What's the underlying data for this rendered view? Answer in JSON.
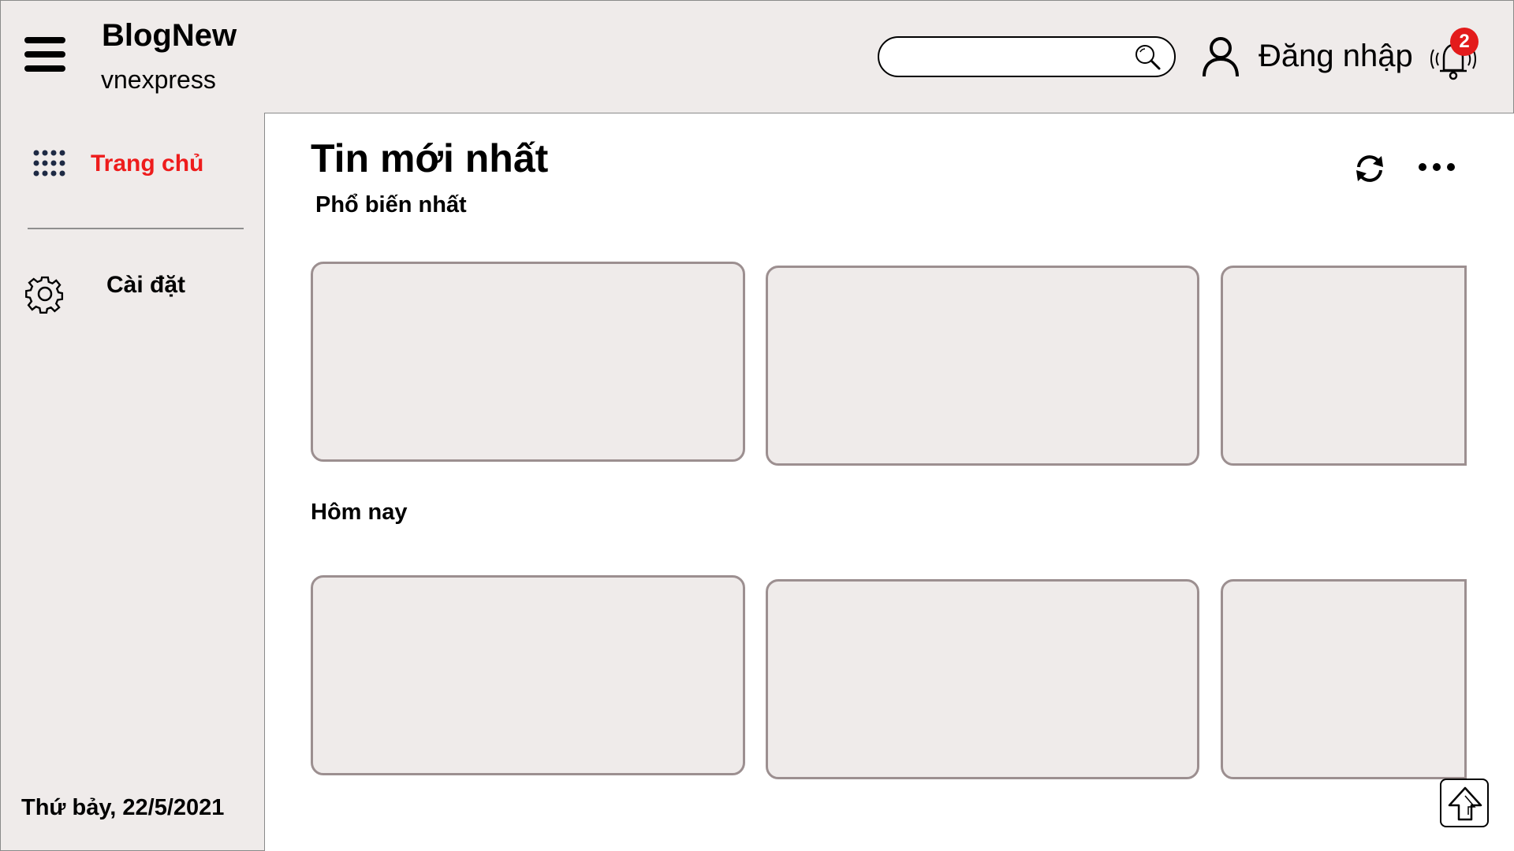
{
  "header": {
    "menu_icon": "hamburger-menu-icon",
    "brand_title": "BlogNew",
    "brand_subtitle": "vnexpress",
    "search": {
      "placeholder": "",
      "value": "",
      "icon": "search-icon"
    },
    "user_icon": "user-icon",
    "login_label": "Đăng nhập",
    "notification_icon": "bell-icon",
    "notification_count": "2"
  },
  "sidebar": {
    "items": [
      {
        "label": "Trang chủ",
        "icon": "grid-icon",
        "active": true
      },
      {
        "label": "Cài đặt",
        "icon": "gear-icon",
        "active": false
      }
    ],
    "date": "Thứ bảy, 22/5/2021"
  },
  "main": {
    "title": "Tin mới nhất",
    "actions": [
      {
        "icon": "refresh-icon"
      },
      {
        "icon": "more-icon"
      }
    ],
    "sections": [
      {
        "title": "Phổ biến nhất",
        "cards": 3
      },
      {
        "title": "Hôm nay",
        "cards": 3
      }
    ],
    "scroll_top_icon": "arrow-up-icon"
  },
  "colors": {
    "panel_bg": "#efebea",
    "accent_red": "#ee1c1c",
    "card_border": "#9c8f90",
    "badge_red": "#e31b1b"
  }
}
